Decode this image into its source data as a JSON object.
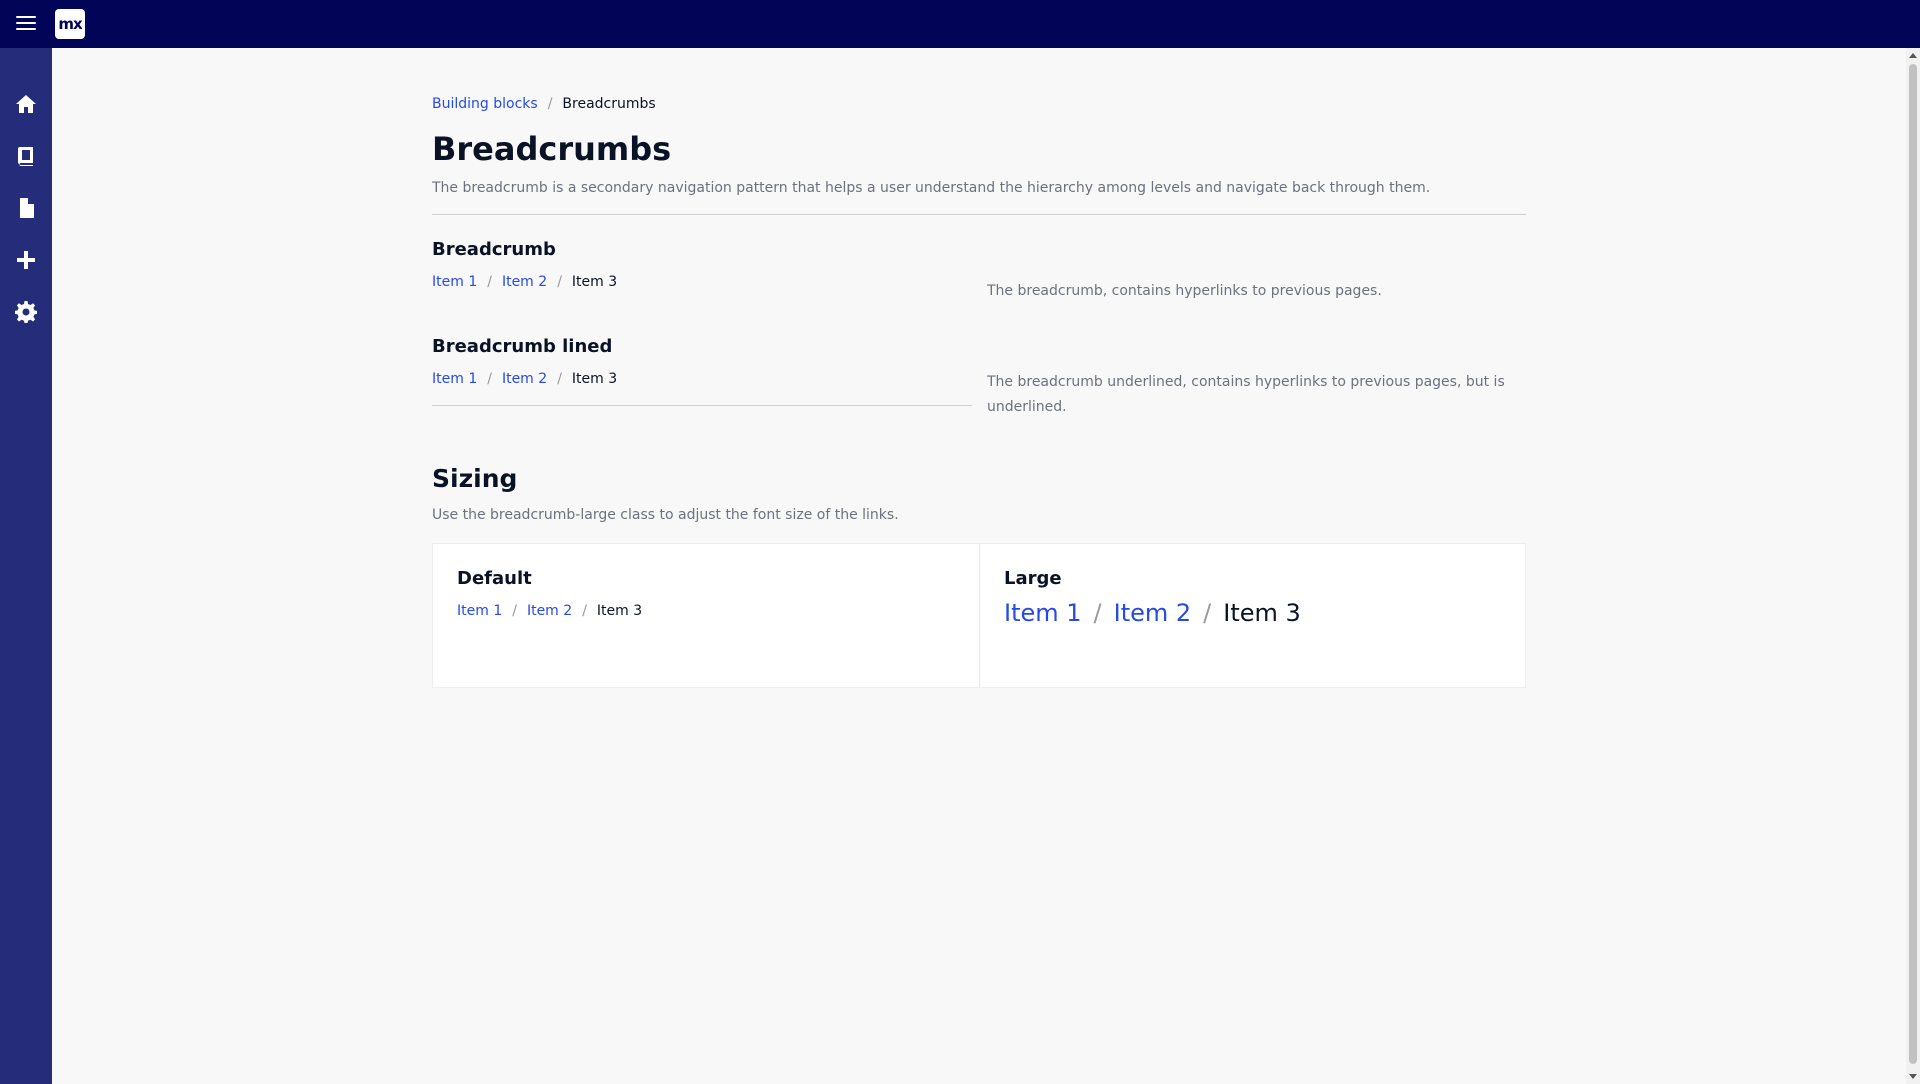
{
  "topbar": {
    "logo": "mx"
  },
  "sidebar": {
    "items": [
      "home-icon",
      "book-icon",
      "file-icon",
      "plus-icon",
      "gear-icon"
    ]
  },
  "breadcrumb": {
    "parent": "Building blocks",
    "current": "Breadcrumbs",
    "separator": "/"
  },
  "page": {
    "title": "Breadcrumbs",
    "description": "The breadcrumb is a secondary navigation pattern that helps a user understand the hierarchy among levels and navigate back through them."
  },
  "examples": {
    "breadcrumb": {
      "title": "Breadcrumb",
      "items": [
        "Item 1",
        "Item 2",
        "Item 3"
      ],
      "description": "The breadcrumb, contains hyperlinks to previous pages."
    },
    "lined": {
      "title": "Breadcrumb lined",
      "items": [
        "Item 1",
        "Item 2",
        "Item 3"
      ],
      "description": "The breadcrumb underlined, contains hyperlinks to previous pages, but is underlined."
    }
  },
  "sizing": {
    "title": "Sizing",
    "description": "Use the breadcrumb-large class to adjust the font size of the links.",
    "default": {
      "title": "Default",
      "items": [
        "Item 1",
        "Item 2",
        "Item 3"
      ]
    },
    "large": {
      "title": "Large",
      "items": [
        "Item 1",
        "Item 2",
        "Item 3"
      ]
    }
  },
  "colors": {
    "topbar": "#020557",
    "sidebar": "#252c7a",
    "link": "#264ae5"
  }
}
